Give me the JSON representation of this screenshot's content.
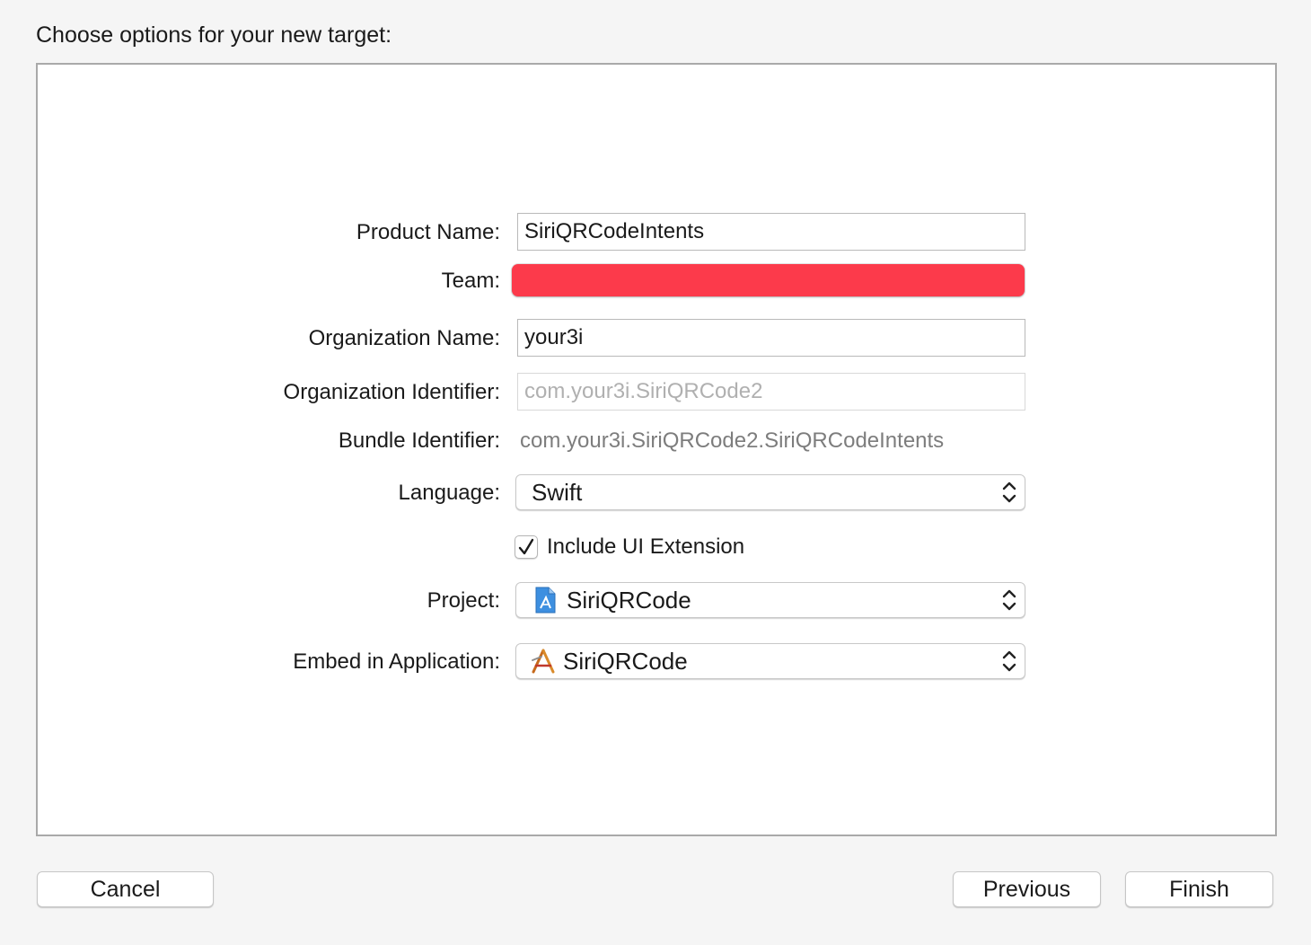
{
  "dialog": {
    "title": "Choose options for your new target:"
  },
  "form": {
    "product_name": {
      "label": "Product Name:",
      "value": "SiriQRCodeIntents"
    },
    "team": {
      "label": "Team:",
      "value": "",
      "color": "#fc3a4b"
    },
    "organization_name": {
      "label": "Organization Name:",
      "value": "your3i"
    },
    "organization_identifier": {
      "label": "Organization Identifier:",
      "value": "",
      "placeholder": "com.your3i.SiriQRCode2"
    },
    "bundle_identifier": {
      "label": "Bundle Identifier:",
      "value": "com.your3i.SiriQRCode2.SiriQRCodeIntents"
    },
    "language": {
      "label": "Language:",
      "value": "Swift"
    },
    "include_ui_extension": {
      "label": "Include UI Extension",
      "checked": true
    },
    "project": {
      "label": "Project:",
      "value": "SiriQRCode",
      "icon": "xcode-project-icon"
    },
    "embed_in_application": {
      "label": "Embed in Application:",
      "value": "SiriQRCode",
      "icon": "app-icon"
    }
  },
  "buttons": {
    "cancel": "Cancel",
    "previous": "Previous",
    "finish": "Finish"
  }
}
